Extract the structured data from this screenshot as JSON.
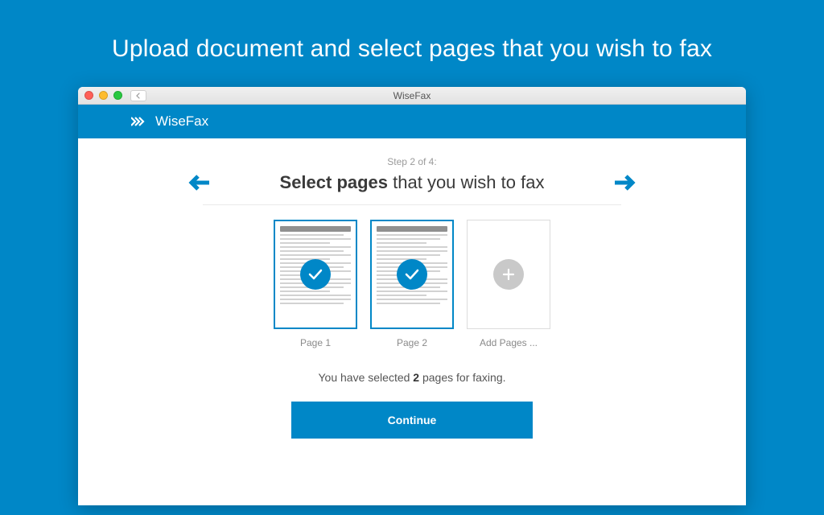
{
  "hero": {
    "title": "Upload document and select pages that you wish to fax"
  },
  "window": {
    "title": "WiseFax"
  },
  "brand": {
    "name": "WiseFax"
  },
  "step": {
    "indicator": "Step 2 of 4:",
    "title_bold": "Select pages",
    "title_rest": " that you wish to fax"
  },
  "pages": [
    {
      "label": "Page 1",
      "selected": true
    },
    {
      "label": "Page 2",
      "selected": true
    }
  ],
  "add_tile": {
    "label": "Add Pages ..."
  },
  "summary": {
    "prefix": "You have selected ",
    "count": "2",
    "suffix": " pages for faxing."
  },
  "actions": {
    "continue": "Continue"
  },
  "colors": {
    "brand": "#0087c7"
  }
}
